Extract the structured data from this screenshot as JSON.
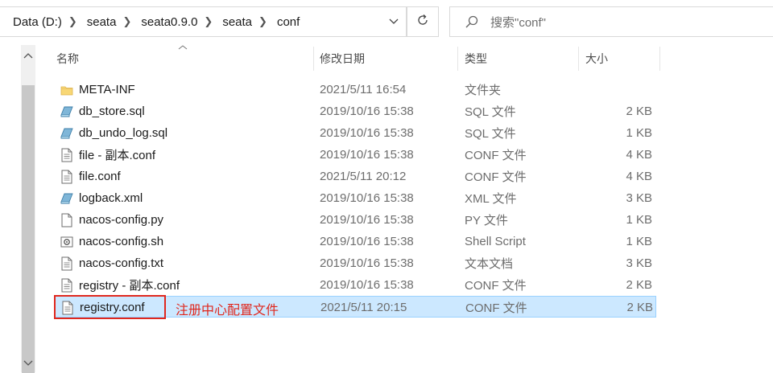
{
  "address_bar": {
    "breadcrumbs": [
      "Data (D:)",
      "seata",
      "seata0.9.0",
      "seata",
      "conf"
    ]
  },
  "search": {
    "placeholder": "搜索\"conf\""
  },
  "columns": {
    "name": "名称",
    "date": "修改日期",
    "type": "类型",
    "size": "大小"
  },
  "files": [
    {
      "name": "META-INF",
      "date": "2021/5/11 16:54",
      "type": "文件夹",
      "size": "",
      "icon": "folder-icon"
    },
    {
      "name": "db_store.sql",
      "date": "2019/10/16 15:38",
      "type": "SQL 文件",
      "size": "2 KB",
      "icon": "sql-file-icon"
    },
    {
      "name": "db_undo_log.sql",
      "date": "2019/10/16 15:38",
      "type": "SQL 文件",
      "size": "1 KB",
      "icon": "sql-file-icon"
    },
    {
      "name": "file - 副本.conf",
      "date": "2019/10/16 15:38",
      "type": "CONF 文件",
      "size": "4 KB",
      "icon": "text-file-icon"
    },
    {
      "name": "file.conf",
      "date": "2021/5/11 20:12",
      "type": "CONF 文件",
      "size": "4 KB",
      "icon": "text-file-icon"
    },
    {
      "name": "logback.xml",
      "date": "2019/10/16 15:38",
      "type": "XML 文件",
      "size": "3 KB",
      "icon": "xml-file-icon"
    },
    {
      "name": "nacos-config.py",
      "date": "2019/10/16 15:38",
      "type": "PY 文件",
      "size": "1 KB",
      "icon": "blank-file-icon"
    },
    {
      "name": "nacos-config.sh",
      "date": "2019/10/16 15:38",
      "type": "Shell Script",
      "size": "1 KB",
      "icon": "script-file-icon"
    },
    {
      "name": "nacos-config.txt",
      "date": "2019/10/16 15:38",
      "type": "文本文档",
      "size": "3 KB",
      "icon": "text-file-icon"
    },
    {
      "name": "registry - 副本.conf",
      "date": "2019/10/16 15:38",
      "type": "CONF 文件",
      "size": "2 KB",
      "icon": "text-file-icon"
    },
    {
      "name": "registry.conf",
      "date": "2021/5/11 20:15",
      "type": "CONF 文件",
      "size": "2 KB",
      "icon": "text-file-icon",
      "selected": true
    }
  ],
  "annotation": {
    "text": "注册中心配置文件",
    "color": "#e0281e"
  },
  "colors": {
    "selection_bg": "#cce8ff",
    "selection_border": "#99d1ff"
  }
}
